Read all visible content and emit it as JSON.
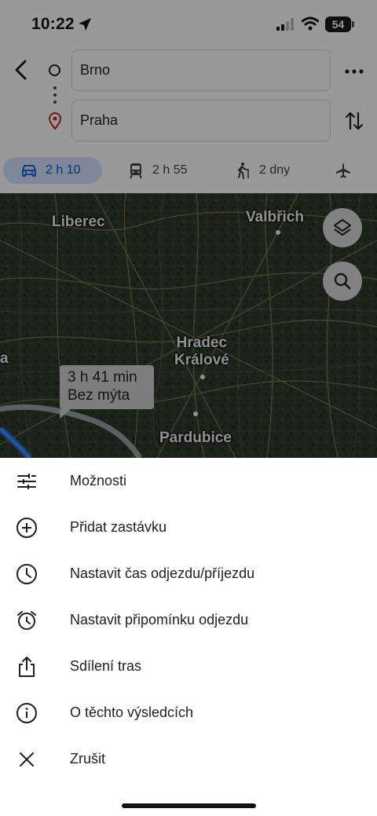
{
  "status_bar": {
    "time": "10:22",
    "battery": "54"
  },
  "directions": {
    "origin": "Brno",
    "destination": "Praha"
  },
  "modes": [
    {
      "icon": "car-icon",
      "label": "2 h 10",
      "selected": true
    },
    {
      "icon": "transit-icon",
      "label": "2 h 55",
      "selected": false
    },
    {
      "icon": "walk-icon",
      "label": "2 dny",
      "selected": false
    },
    {
      "icon": "flight-icon",
      "label": "",
      "selected": false
    }
  ],
  "map": {
    "cities": {
      "liberec": "Liberec",
      "walbrzych": "Valbřich",
      "hradec": "Hradec\nKrálové",
      "pardubice": "Pardubice",
      "edge": "a"
    },
    "route_callout": {
      "duration": "3 h 41 min",
      "note": "Bez mýta"
    }
  },
  "menu": {
    "options": "Možnosti",
    "add_stop": "Přidat zastávku",
    "set_time": "Nastavit čas odjezdu/příjezdu",
    "set_reminder": "Nastavit připomínku odjezdu",
    "share": "Sdílení tras",
    "about": "O těchto výsledcích",
    "cancel": "Zrušit"
  },
  "colors": {
    "selected_mode_bg": "#d3e3fd",
    "selected_mode_text": "#0b57d0",
    "route_blue": "#1a73e8"
  }
}
